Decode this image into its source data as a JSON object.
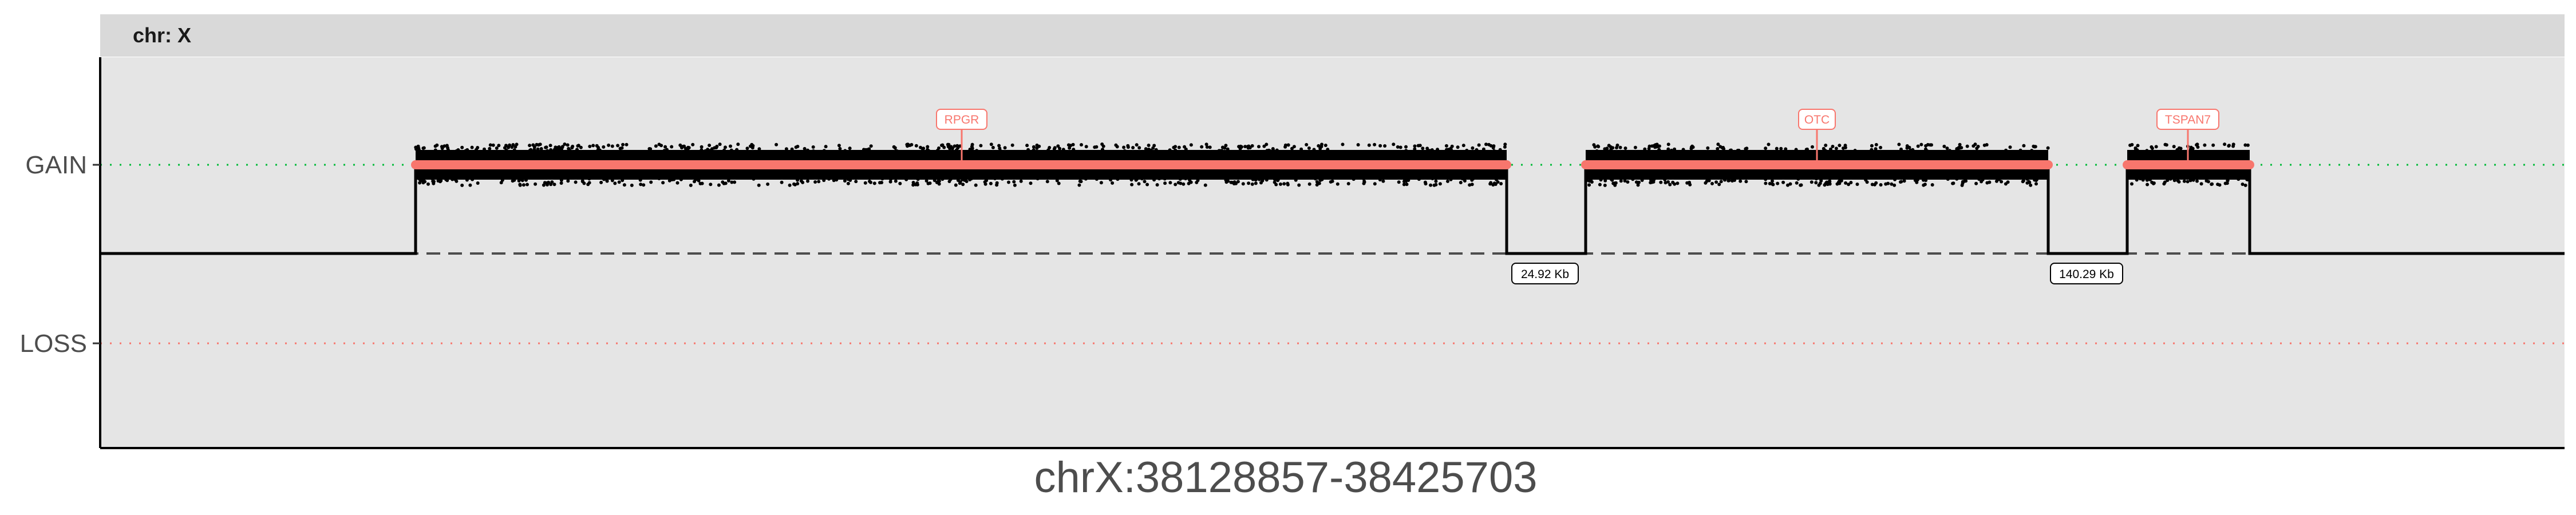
{
  "chart_data": {
    "type": "line",
    "panel_title": "chr: X",
    "xlabel": "chrX:38128857-38425703",
    "y_levels": [
      "GAIN",
      "LOSS"
    ],
    "segments": [
      {
        "state": "GAIN",
        "gene": "RPGR"
      },
      {
        "state": "GAIN",
        "gene": "OTC"
      },
      {
        "state": "GAIN",
        "gene": "TSPAN7"
      }
    ],
    "gaps": [
      {
        "label": "24.92 Kb"
      },
      {
        "label": "140.29 Kb"
      }
    ],
    "colors": {
      "panel_bg": "#e5e5e5",
      "strip_bg": "#d9d9d9",
      "segment": "#f8766d",
      "points": "#000000",
      "gain_ref": "#00ba38",
      "loss_ref": "#f8766d"
    }
  }
}
